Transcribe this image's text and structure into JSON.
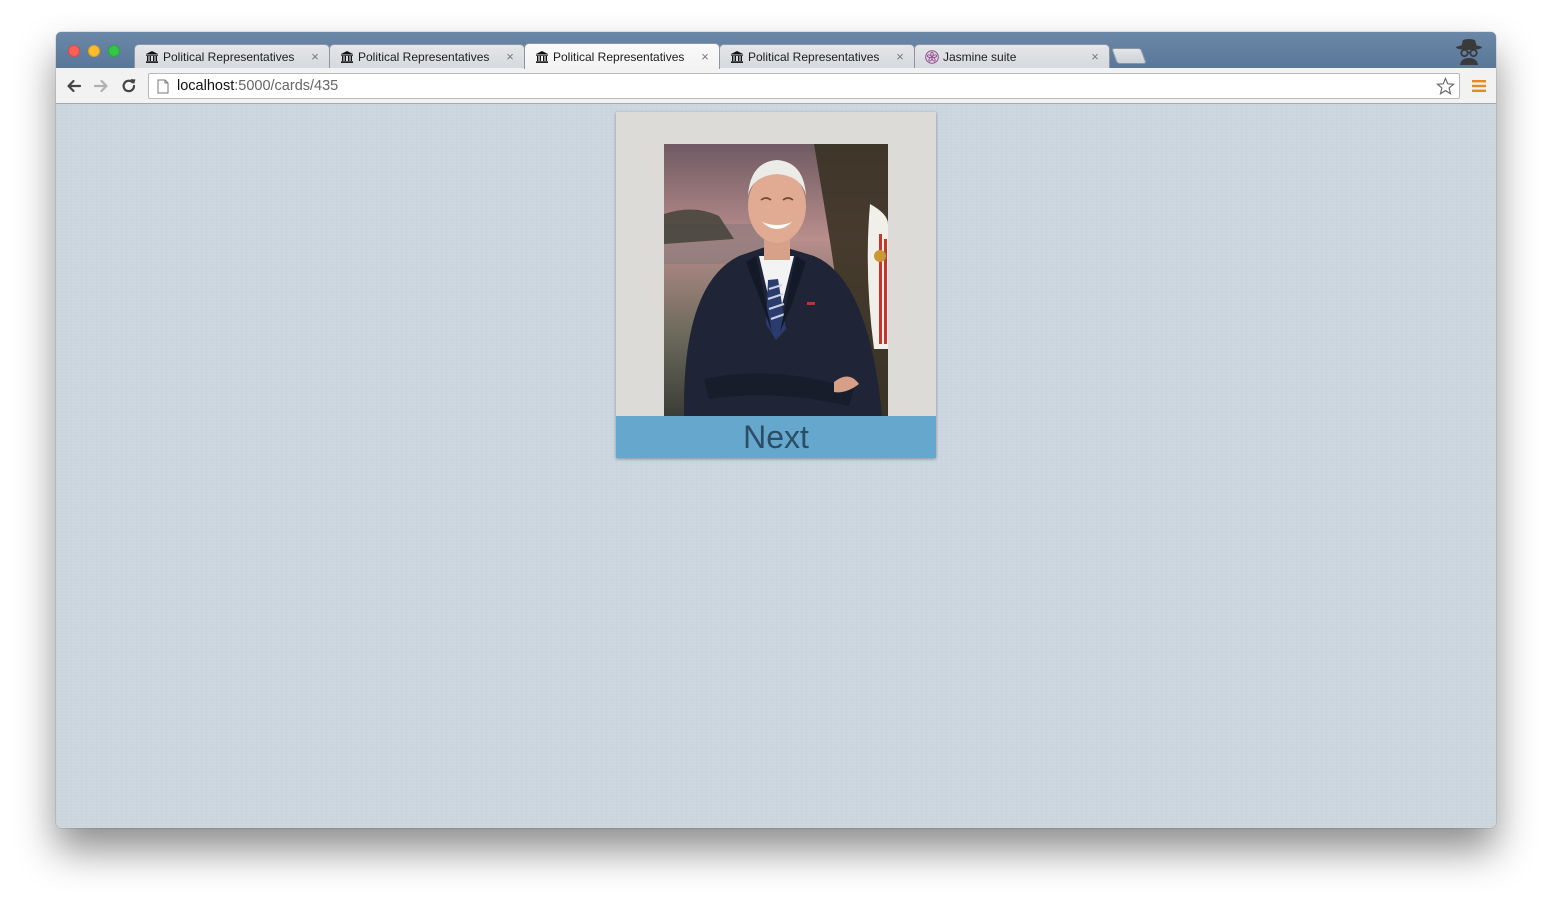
{
  "browser": {
    "tabs": [
      {
        "title": "Political Representatives",
        "icon": "building-columns-icon",
        "active": false
      },
      {
        "title": "Political Representatives",
        "icon": "building-columns-icon",
        "active": false
      },
      {
        "title": "Political Representatives",
        "icon": "building-columns-icon",
        "active": true
      },
      {
        "title": "Political Representatives",
        "icon": "building-columns-icon",
        "active": false
      },
      {
        "title": "Jasmine suite",
        "icon": "jasmine-flower-icon",
        "active": false
      }
    ],
    "tab_close_glyph": "×",
    "address": {
      "host": "localhost",
      "path": ":5000/cards/435"
    }
  },
  "card": {
    "photo_subject": "portrait photo",
    "next_label": "Next"
  },
  "colors": {
    "page_background": "#cbd6df",
    "card_background": "#dcdbd7",
    "next_button": "#66a8cd",
    "next_text": "#2c4d66"
  }
}
